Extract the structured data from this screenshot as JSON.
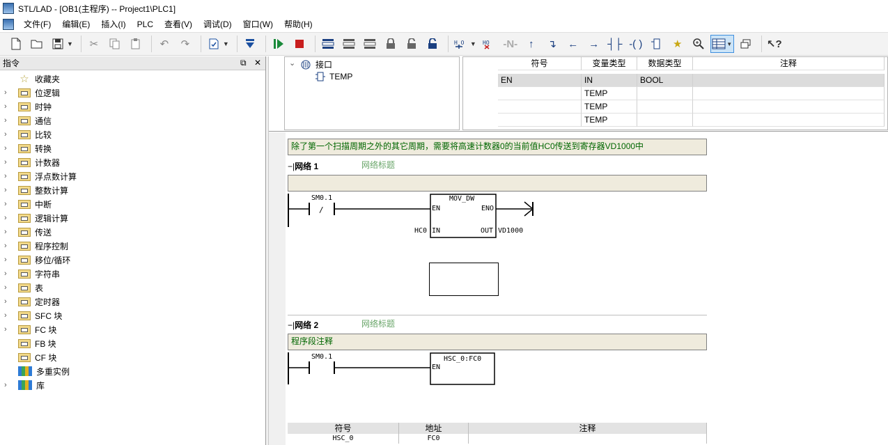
{
  "window": {
    "title": "STL/LAD - [OB1(主程序) -- Project1\\PLC1]"
  },
  "menu": [
    "文件(F)",
    "编辑(E)",
    "插入(I)",
    "PLC",
    "查看(V)",
    "调试(D)",
    "窗口(W)",
    "帮助(H)"
  ],
  "toolbar": {
    "buttons": [
      {
        "name": "new-icon",
        "glyph": "🗋"
      },
      {
        "name": "open-icon",
        "glyph": "📂"
      },
      {
        "name": "save-icon",
        "glyph": "💾"
      },
      {
        "name": "cut-icon",
        "glyph": "✂"
      },
      {
        "name": "copy-icon",
        "glyph": "⎘"
      },
      {
        "name": "paste-icon",
        "glyph": "📋"
      },
      {
        "name": "undo-icon",
        "glyph": "↶"
      },
      {
        "name": "redo-icon",
        "glyph": "↷"
      },
      {
        "name": "compile-icon",
        "glyph": "🗎"
      },
      {
        "name": "download-icon",
        "glyph": "⬇"
      },
      {
        "name": "run-icon",
        "glyph": "▶"
      },
      {
        "name": "stop-icon",
        "glyph": "■"
      }
    ],
    "accent": "#3e8ede"
  },
  "left_panel": {
    "title": "指令",
    "items": [
      {
        "label": "收藏夹",
        "kind": "star",
        "expandable": false
      },
      {
        "label": "位逻辑",
        "kind": "folder",
        "expandable": true
      },
      {
        "label": "时钟",
        "kind": "folder",
        "expandable": true
      },
      {
        "label": "通信",
        "kind": "folder",
        "expandable": true
      },
      {
        "label": "比较",
        "kind": "folder",
        "expandable": true
      },
      {
        "label": "转换",
        "kind": "folder",
        "expandable": true
      },
      {
        "label": "计数器",
        "kind": "folder",
        "expandable": true
      },
      {
        "label": "浮点数计算",
        "kind": "folder",
        "expandable": true
      },
      {
        "label": "整数计算",
        "kind": "folder",
        "expandable": true
      },
      {
        "label": "中断",
        "kind": "folder",
        "expandable": true
      },
      {
        "label": "逻辑计算",
        "kind": "folder",
        "expandable": true
      },
      {
        "label": "传送",
        "kind": "folder",
        "expandable": true
      },
      {
        "label": "程序控制",
        "kind": "folder",
        "expandable": true
      },
      {
        "label": "移位/循环",
        "kind": "folder",
        "expandable": true
      },
      {
        "label": "字符串",
        "kind": "folder",
        "expandable": true
      },
      {
        "label": "表",
        "kind": "folder",
        "expandable": true
      },
      {
        "label": "定时器",
        "kind": "folder",
        "expandable": true
      },
      {
        "label": "SFC 块",
        "kind": "folder",
        "expandable": true
      },
      {
        "label": "FC 块",
        "kind": "folder",
        "expandable": true
      },
      {
        "label": "FB 块",
        "kind": "folder",
        "expandable": false
      },
      {
        "label": "CF 块",
        "kind": "folder",
        "expandable": false
      },
      {
        "label": "多重实例",
        "kind": "books",
        "expandable": false
      },
      {
        "label": "库",
        "kind": "books",
        "expandable": true
      }
    ]
  },
  "interface": {
    "tree": {
      "root": "接口",
      "child": "TEMP"
    },
    "columns": [
      "符号",
      "变量类型",
      "数据类型",
      "注释"
    ],
    "rows": [
      [
        "EN",
        "IN",
        "BOOL",
        ""
      ],
      [
        "",
        "TEMP",
        "",
        ""
      ],
      [
        "",
        "TEMP",
        "",
        ""
      ],
      [
        "",
        "TEMP",
        "",
        ""
      ]
    ]
  },
  "editor": {
    "block_comment": "除了第一个扫描周期之外的其它周期，需要将高速计数器0的当前值HC0传送到寄存器VD1000中",
    "networks": [
      {
        "label": "网络 1",
        "title": "网络标题",
        "comment": "",
        "contact": "SM0.1",
        "contact_not": "/",
        "box_title": "MOV_DW",
        "en": "EN",
        "eno": "ENO",
        "in_pin": "IN",
        "out_pin": "OUT",
        "in_operand": "HC0",
        "out_operand": "VD1000"
      },
      {
        "label": "网络 2",
        "title": "网络标题",
        "comment": "程序段注释",
        "contact": "SM0.1",
        "box_title": "HSC_0:FC0",
        "en": "EN"
      }
    ],
    "symbol_table": {
      "columns": [
        "符号",
        "地址",
        "注释"
      ],
      "rows": [
        [
          "HSC_0",
          "FC0",
          ""
        ]
      ]
    }
  }
}
